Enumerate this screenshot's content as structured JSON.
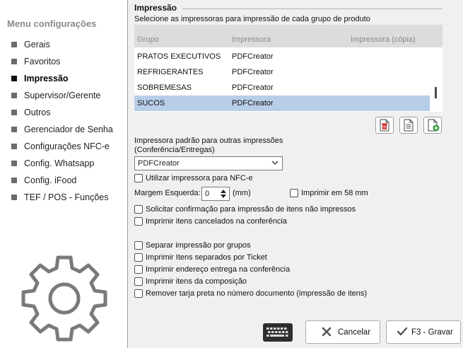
{
  "sidebar": {
    "title": "Menu configurações",
    "items": [
      {
        "label": "Gerais"
      },
      {
        "label": "Favoritos"
      },
      {
        "label": "Impressão"
      },
      {
        "label": "Supervisor/Gerente"
      },
      {
        "label": "Outros"
      },
      {
        "label": "Gerenciador de Senha"
      },
      {
        "label": "Configurações NFC-e"
      },
      {
        "label": "Config. Whatsapp"
      },
      {
        "label": "Config. iFood"
      },
      {
        "label": "TEF / POS - Funções"
      }
    ],
    "active_index": 2,
    "logo_icon": "gear-icon"
  },
  "section": {
    "title": "Impressão",
    "subtitle": "Selecione as impressoras para impressão de cada grupo de produto"
  },
  "grid": {
    "columns": [
      "Grupo",
      "Impressora",
      "Impressora (cópia)"
    ],
    "rows": [
      {
        "group": "PRATOS EXECUTIVOS",
        "printer": "PDFCreator",
        "copy": ""
      },
      {
        "group": "REFRIGERANTES",
        "printer": "PDFCreator",
        "copy": ""
      },
      {
        "group": "SOBREMESAS",
        "printer": "PDFCreator",
        "copy": ""
      },
      {
        "group": "SUCOS",
        "printer": "PDFCreator",
        "copy": ""
      }
    ],
    "selected_index": 3
  },
  "grid_actions": {
    "delete_icon": "delete-document-icon",
    "edit_icon": "document-icon",
    "add_icon": "add-document-icon"
  },
  "default_printer": {
    "label_line1": "Impressora padrão para outras impressões",
    "label_line2": "(Conferência/Entregas)",
    "value": "PDFCreator"
  },
  "options": {
    "use_nfce_printer": {
      "label": "Utilizar impressora para NFC-e",
      "checked": false
    },
    "margin_label": "Margem Esquerda:",
    "margin_value": "0",
    "margin_unit": "(mm)",
    "print_58mm": {
      "label": "Imprimir em 58 mm",
      "checked": false
    },
    "confirm_unprinted": {
      "label": "Solicitar confirmação para impressão de itens não impressos",
      "checked": false
    },
    "print_cancelled": {
      "label": "Imprimir itens cancelados na conferência",
      "checked": false
    },
    "separate_groups": {
      "label": "Separar impressão por grupos",
      "checked": false
    },
    "separate_ticket": {
      "label": "Imprimir Itens separados por Ticket",
      "checked": false
    },
    "print_address": {
      "label": "Imprimir endereço entrega na conferência",
      "checked": false
    },
    "print_composition": {
      "label": "Imprimir itens da composição",
      "checked": false
    },
    "remove_black_bar": {
      "label": "Remover tarja preta no número documento (impressão de itens)",
      "checked": false
    }
  },
  "footer": {
    "keyboard_icon": "keyboard-icon",
    "cancel_label": "Cancelar",
    "save_label": "F3 - Gravar"
  },
  "colors": {
    "selected_row": "#b8cde8",
    "delete_red": "#cc1f1f",
    "add_green": "#2e9b3a"
  }
}
